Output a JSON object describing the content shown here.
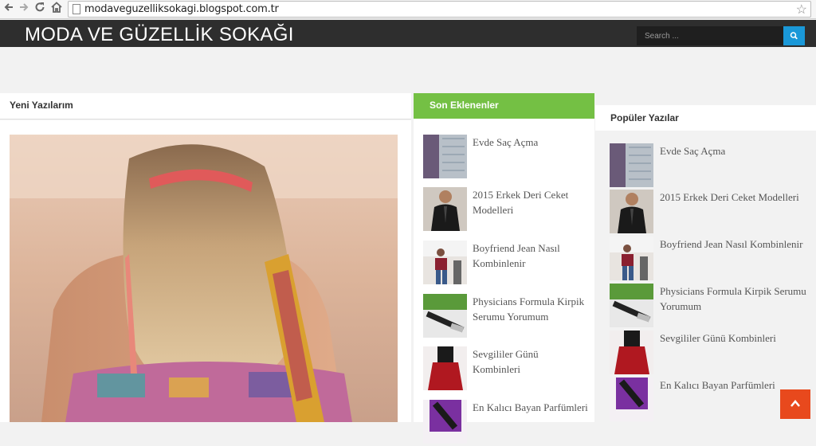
{
  "browser": {
    "url": "modaveguzelliksokagi.blogspot.com.tr",
    "back_icon": "arrow-left-icon",
    "forward_icon": "arrow-right-icon",
    "reload_icon": "reload-icon",
    "home_icon": "home-icon",
    "bookmark_icon": "star-icon"
  },
  "site": {
    "title": "MODA VE GÜZELLİK SOKAĞI",
    "search_placeholder": "Search ...",
    "search_icon": "search-icon"
  },
  "columns": {
    "latest_header": "Yeni Yazılarım",
    "recent_header": "Son Eklenenler",
    "popular_header": "Popüler Yazılar"
  },
  "recent_posts": [
    {
      "title": "Evde Saç Açma"
    },
    {
      "title": "2015 Erkek Deri Ceket Modelleri"
    },
    {
      "title": "Boyfriend Jean Nasıl Kombinlenir"
    },
    {
      "title": "Physicians Formula Kirpik Serumu Yorumum"
    },
    {
      "title": "Sevgililer Günü Kombinleri"
    },
    {
      "title": "En Kalıcı Bayan Parfümleri"
    }
  ],
  "popular_posts": [
    {
      "title": "Evde Saç Açma"
    },
    {
      "title": "2015 Erkek Deri Ceket Modelleri"
    },
    {
      "title": "Boyfriend Jean Nasıl Kombinlenir"
    },
    {
      "title": "Physicians Formula Kirpik Serumu Yorumum"
    },
    {
      "title": "Sevgililer Günü Kombinleri"
    },
    {
      "title": "En Kalıcı Bayan Parfümleri"
    }
  ],
  "colors": {
    "header_bg": "#2e2e2e",
    "accent_green": "#74c044",
    "search_blue": "#1a98d8",
    "scroll_top_orange": "#e8491d"
  },
  "scroll_top_icon": "chevron-up-icon"
}
